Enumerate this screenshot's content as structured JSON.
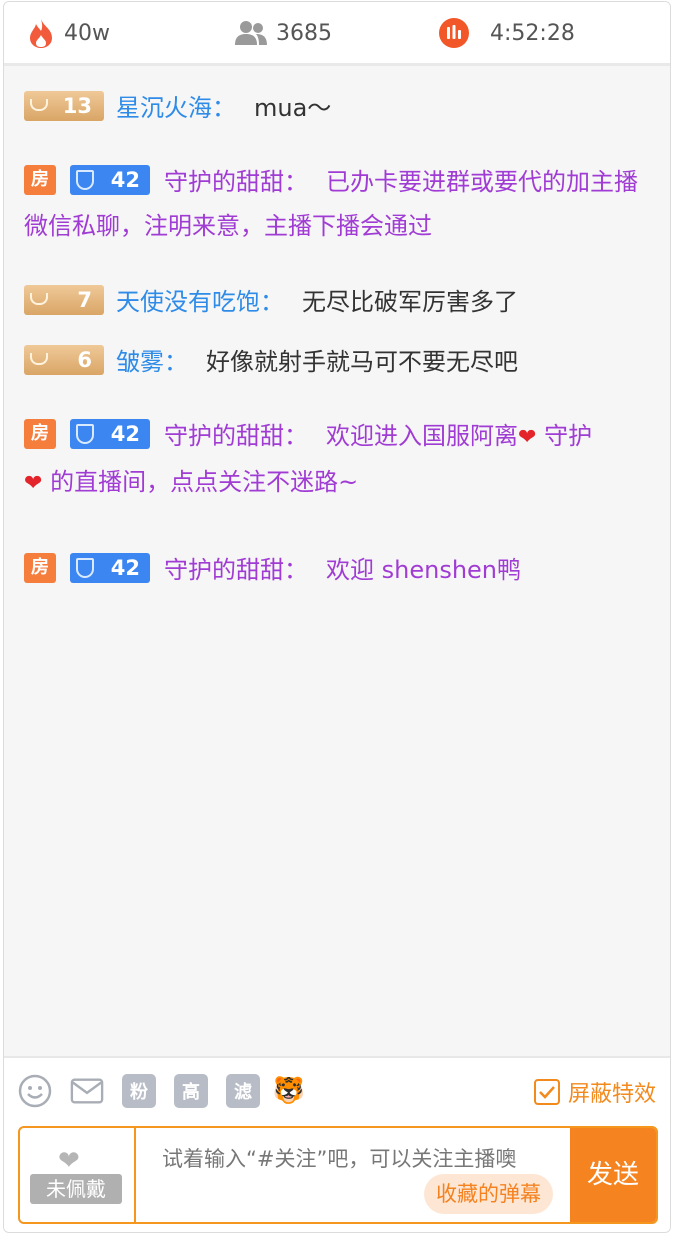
{
  "stats": {
    "popularity": "40w",
    "viewers": "3685",
    "duration": "4:52:28"
  },
  "badges": {
    "room_label": "房"
  },
  "messages": [
    {
      "fan_level": "13",
      "name": "星沉火海：",
      "text": "mua～"
    },
    {
      "guard_level": "42",
      "name": "守护的甜甜：",
      "text": "已办卡要进群或要代的加主播微信私聊，注明来意，主播下播会通过"
    },
    {
      "fan_level": "7",
      "name": "天使没有吃饱：",
      "text": "无尽比破军厉害多了"
    },
    {
      "fan_level": "6",
      "name": "皱雾：",
      "text": "好像就射手就马可不要无尽吧"
    },
    {
      "guard_level": "42",
      "name": "守护的甜甜：",
      "text_a": "欢迎进入国服阿离",
      "text_b": " 守护",
      "text_c": " 的直播间，点点关注不迷路~"
    },
    {
      "guard_level": "42",
      "name": "守护的甜甜：",
      "text": "欢迎 shenshen鸭"
    }
  ],
  "toolbar": {
    "fans_label": "粉",
    "high_label": "高",
    "filter_label": "滤",
    "tiger_emoji": "🐯",
    "shield_effects_label": "屏蔽特效"
  },
  "input": {
    "wear_label": "未佩戴",
    "placeholder": "试着输入“#关注”吧，可以关注主播噢",
    "favorites_label": "收藏的弹幕",
    "send_label": "发送"
  },
  "colors": {
    "accent": "#f5831f",
    "name_blue": "#2e8be8",
    "guard_purple": "#a03cd4"
  }
}
